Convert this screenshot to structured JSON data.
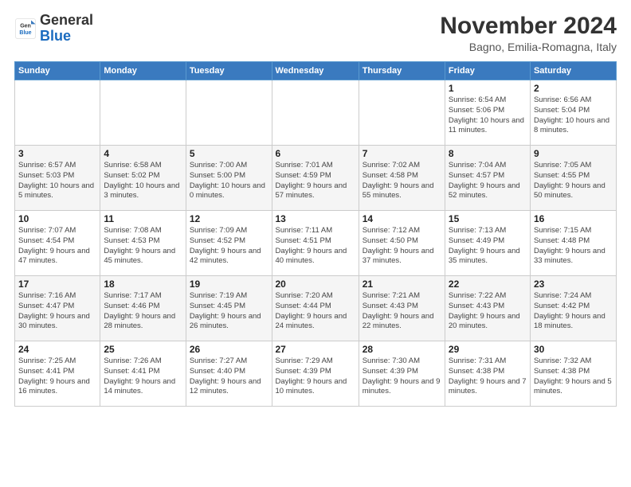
{
  "logo": {
    "general": "General",
    "blue": "Blue"
  },
  "header": {
    "month": "November 2024",
    "location": "Bagno, Emilia-Romagna, Italy"
  },
  "weekdays": [
    "Sunday",
    "Monday",
    "Tuesday",
    "Wednesday",
    "Thursday",
    "Friday",
    "Saturday"
  ],
  "weeks": [
    [
      {
        "day": "",
        "info": ""
      },
      {
        "day": "",
        "info": ""
      },
      {
        "day": "",
        "info": ""
      },
      {
        "day": "",
        "info": ""
      },
      {
        "day": "",
        "info": ""
      },
      {
        "day": "1",
        "info": "Sunrise: 6:54 AM\nSunset: 5:06 PM\nDaylight: 10 hours and 11 minutes."
      },
      {
        "day": "2",
        "info": "Sunrise: 6:56 AM\nSunset: 5:04 PM\nDaylight: 10 hours and 8 minutes."
      }
    ],
    [
      {
        "day": "3",
        "info": "Sunrise: 6:57 AM\nSunset: 5:03 PM\nDaylight: 10 hours and 5 minutes."
      },
      {
        "day": "4",
        "info": "Sunrise: 6:58 AM\nSunset: 5:02 PM\nDaylight: 10 hours and 3 minutes."
      },
      {
        "day": "5",
        "info": "Sunrise: 7:00 AM\nSunset: 5:00 PM\nDaylight: 10 hours and 0 minutes."
      },
      {
        "day": "6",
        "info": "Sunrise: 7:01 AM\nSunset: 4:59 PM\nDaylight: 9 hours and 57 minutes."
      },
      {
        "day": "7",
        "info": "Sunrise: 7:02 AM\nSunset: 4:58 PM\nDaylight: 9 hours and 55 minutes."
      },
      {
        "day": "8",
        "info": "Sunrise: 7:04 AM\nSunset: 4:57 PM\nDaylight: 9 hours and 52 minutes."
      },
      {
        "day": "9",
        "info": "Sunrise: 7:05 AM\nSunset: 4:55 PM\nDaylight: 9 hours and 50 minutes."
      }
    ],
    [
      {
        "day": "10",
        "info": "Sunrise: 7:07 AM\nSunset: 4:54 PM\nDaylight: 9 hours and 47 minutes."
      },
      {
        "day": "11",
        "info": "Sunrise: 7:08 AM\nSunset: 4:53 PM\nDaylight: 9 hours and 45 minutes."
      },
      {
        "day": "12",
        "info": "Sunrise: 7:09 AM\nSunset: 4:52 PM\nDaylight: 9 hours and 42 minutes."
      },
      {
        "day": "13",
        "info": "Sunrise: 7:11 AM\nSunset: 4:51 PM\nDaylight: 9 hours and 40 minutes."
      },
      {
        "day": "14",
        "info": "Sunrise: 7:12 AM\nSunset: 4:50 PM\nDaylight: 9 hours and 37 minutes."
      },
      {
        "day": "15",
        "info": "Sunrise: 7:13 AM\nSunset: 4:49 PM\nDaylight: 9 hours and 35 minutes."
      },
      {
        "day": "16",
        "info": "Sunrise: 7:15 AM\nSunset: 4:48 PM\nDaylight: 9 hours and 33 minutes."
      }
    ],
    [
      {
        "day": "17",
        "info": "Sunrise: 7:16 AM\nSunset: 4:47 PM\nDaylight: 9 hours and 30 minutes."
      },
      {
        "day": "18",
        "info": "Sunrise: 7:17 AM\nSunset: 4:46 PM\nDaylight: 9 hours and 28 minutes."
      },
      {
        "day": "19",
        "info": "Sunrise: 7:19 AM\nSunset: 4:45 PM\nDaylight: 9 hours and 26 minutes."
      },
      {
        "day": "20",
        "info": "Sunrise: 7:20 AM\nSunset: 4:44 PM\nDaylight: 9 hours and 24 minutes."
      },
      {
        "day": "21",
        "info": "Sunrise: 7:21 AM\nSunset: 4:43 PM\nDaylight: 9 hours and 22 minutes."
      },
      {
        "day": "22",
        "info": "Sunrise: 7:22 AM\nSunset: 4:43 PM\nDaylight: 9 hours and 20 minutes."
      },
      {
        "day": "23",
        "info": "Sunrise: 7:24 AM\nSunset: 4:42 PM\nDaylight: 9 hours and 18 minutes."
      }
    ],
    [
      {
        "day": "24",
        "info": "Sunrise: 7:25 AM\nSunset: 4:41 PM\nDaylight: 9 hours and 16 minutes."
      },
      {
        "day": "25",
        "info": "Sunrise: 7:26 AM\nSunset: 4:41 PM\nDaylight: 9 hours and 14 minutes."
      },
      {
        "day": "26",
        "info": "Sunrise: 7:27 AM\nSunset: 4:40 PM\nDaylight: 9 hours and 12 minutes."
      },
      {
        "day": "27",
        "info": "Sunrise: 7:29 AM\nSunset: 4:39 PM\nDaylight: 9 hours and 10 minutes."
      },
      {
        "day": "28",
        "info": "Sunrise: 7:30 AM\nSunset: 4:39 PM\nDaylight: 9 hours and 9 minutes."
      },
      {
        "day": "29",
        "info": "Sunrise: 7:31 AM\nSunset: 4:38 PM\nDaylight: 9 hours and 7 minutes."
      },
      {
        "day": "30",
        "info": "Sunrise: 7:32 AM\nSunset: 4:38 PM\nDaylight: 9 hours and 5 minutes."
      }
    ]
  ]
}
